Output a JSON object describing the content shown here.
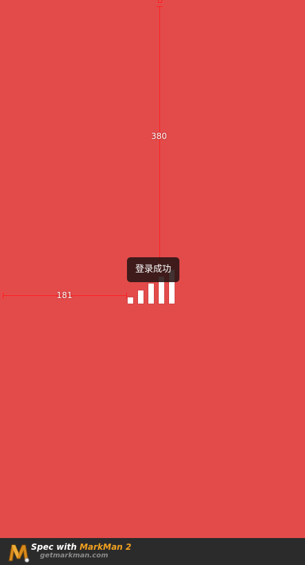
{
  "measurements": {
    "vertical_label": "380",
    "horizontal_label": "181"
  },
  "toast": {
    "message": "登录成功"
  },
  "loading": {
    "bar_count": 5
  },
  "footer": {
    "spec_prefix": "Spec with ",
    "brand": "MarkMan 2",
    "site": "getmarkman.com",
    "logo_icon": "markman-logo-icon"
  },
  "colors": {
    "background": "#e34b4b",
    "measure_line": "#ff1e1e",
    "toast_bg": "#281414",
    "footer_bg": "#2b2b2b",
    "brand": "#f0a020"
  }
}
